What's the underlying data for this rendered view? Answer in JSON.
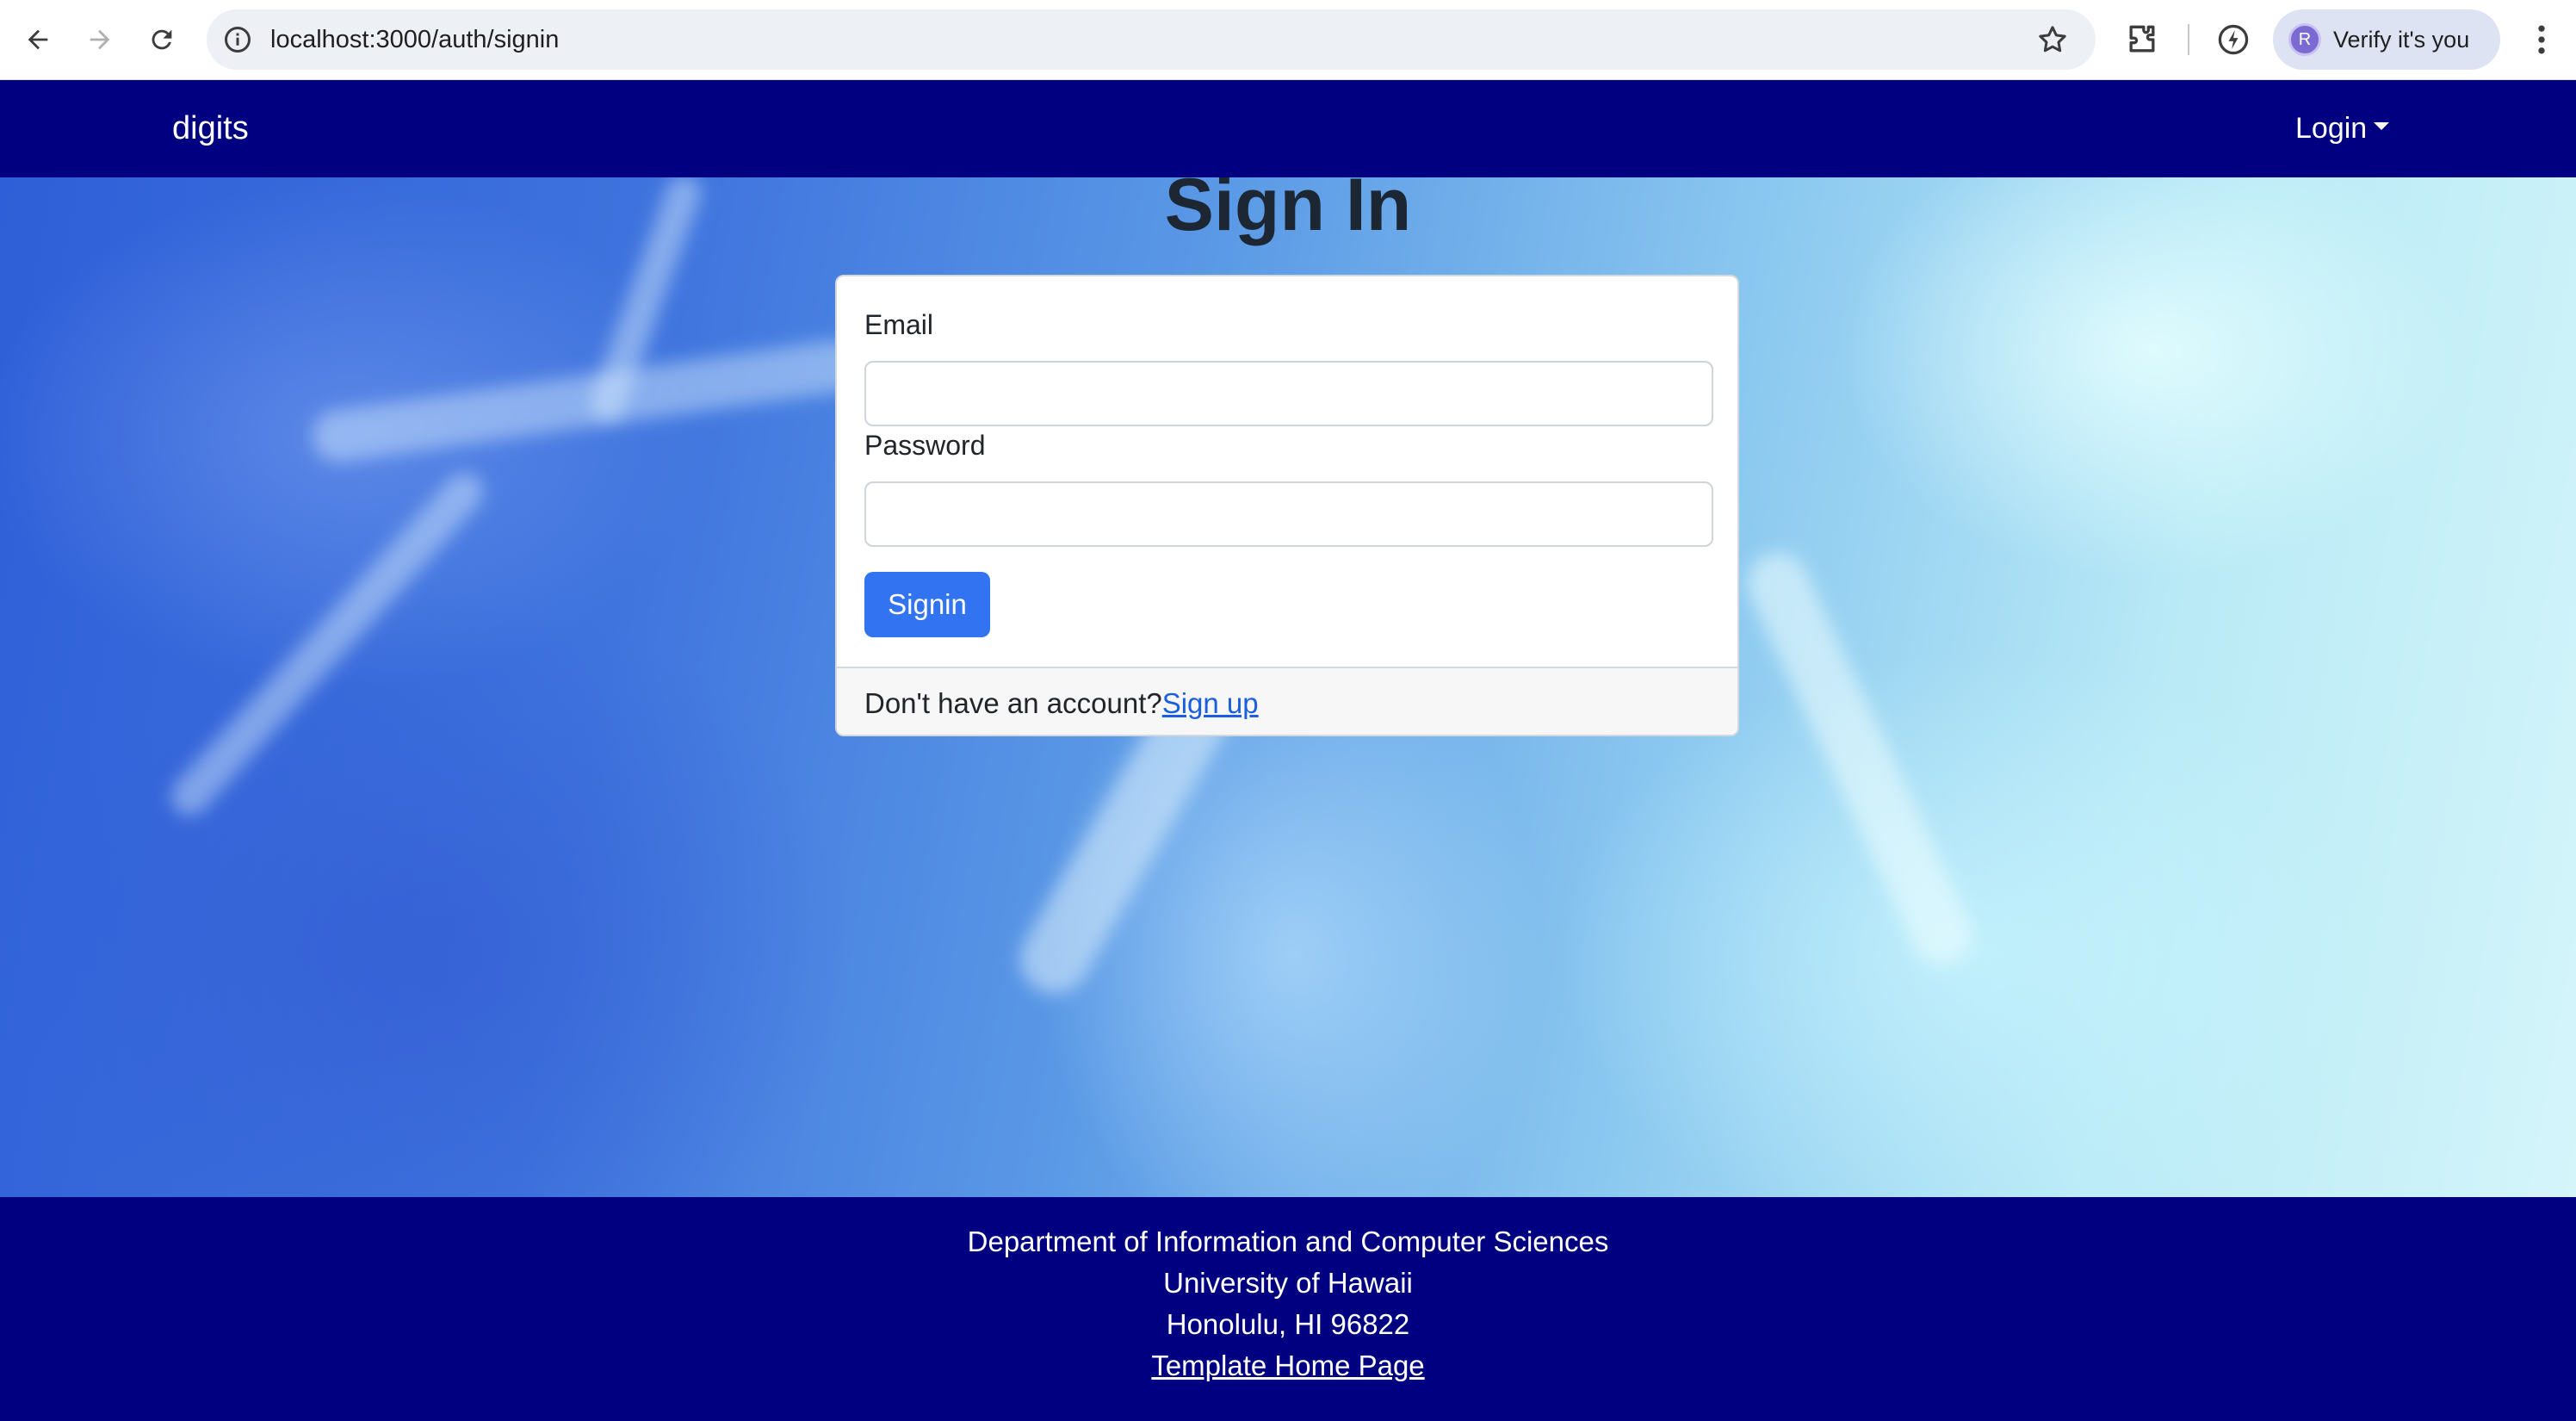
{
  "browser": {
    "url": "localhost:3000/auth/signin",
    "profile_label": "Verify it's you",
    "profile_initial": "R",
    "icons": [
      "back-arrow-icon",
      "forward-arrow-icon",
      "reload-icon",
      "site-info-icon",
      "bookmark-star-icon",
      "extensions-icon",
      "performance-icon",
      "more-menu-icon"
    ]
  },
  "navbar": {
    "brand": "digits",
    "login_menu": "Login"
  },
  "signin": {
    "title": "Sign In",
    "email_label": "Email",
    "email_value": "",
    "password_label": "Password",
    "password_value": "",
    "submit_label": "Signin",
    "footer_text": "Don't have an account?",
    "signup_link": "Sign up"
  },
  "footer": {
    "line1": "Department of Information and Computer Sciences",
    "line2": "University of Hawaii",
    "line3": "Honolulu, HI 96822",
    "link": "Template Home Page"
  },
  "colors": {
    "navbar": "#000080",
    "primary_button": "#3173f0",
    "link": "#1a5fe0"
  }
}
